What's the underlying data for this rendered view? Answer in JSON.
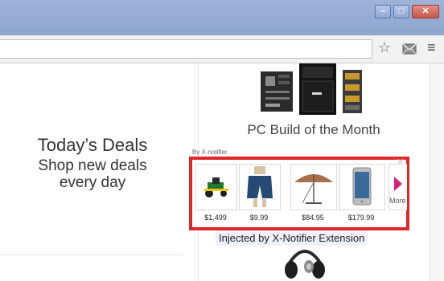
{
  "window": {
    "minimize_glyph": "–",
    "maximize_glyph": "□",
    "close_glyph": "✕"
  },
  "toolbar": {
    "star_icon": "☆",
    "menu_icon": "≡"
  },
  "left": {
    "deals_title": "Today’s Deals",
    "deals_sub_line1": "Shop new deals",
    "deals_sub_line2": "every day"
  },
  "right": {
    "pc_title": "PC Build of the Month"
  },
  "extension": {
    "by_label": "By X-notifier",
    "close_glyph": "✕",
    "more_label": "More",
    "products": [
      {
        "name": "riding-mower",
        "price": "$1,499"
      },
      {
        "name": "shorts",
        "price": "$9.99"
      },
      {
        "name": "patio-umbrella",
        "price": "$84.95"
      },
      {
        "name": "smartphone",
        "price": "$179.99"
      }
    ]
  },
  "injected_label": "Injected by X-Notifier Extension",
  "colors": {
    "highlight_border": "#e02727",
    "more_arrow": "#d6217a"
  }
}
